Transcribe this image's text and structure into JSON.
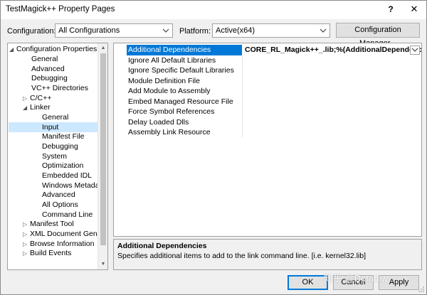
{
  "window": {
    "title": "TestMagick++ Property Pages",
    "help": "?",
    "close": "✕"
  },
  "config": {
    "configuration_label": "Configuration:",
    "configuration_value": "All Configurations",
    "platform_label": "Platform:",
    "platform_value": "Active(x64)",
    "manager_button": "Configuration Manager..."
  },
  "tree": {
    "items": [
      {
        "label": "Configuration Properties",
        "expander": "◢"
      },
      {
        "label": "General"
      },
      {
        "label": "Advanced"
      },
      {
        "label": "Debugging"
      },
      {
        "label": "VC++ Directories"
      },
      {
        "label": "C/C++",
        "expander": "▷"
      },
      {
        "label": "Linker",
        "expander": "◢"
      },
      {
        "label": "General"
      },
      {
        "label": "Input"
      },
      {
        "label": "Manifest File"
      },
      {
        "label": "Debugging"
      },
      {
        "label": "System"
      },
      {
        "label": "Optimization"
      },
      {
        "label": "Embedded IDL"
      },
      {
        "label": "Windows Metadata"
      },
      {
        "label": "Advanced"
      },
      {
        "label": "All Options"
      },
      {
        "label": "Command Line"
      },
      {
        "label": "Manifest Tool",
        "expander": "▷"
      },
      {
        "label": "XML Document Genera",
        "expander": "▷"
      },
      {
        "label": "Browse Information",
        "expander": "▷"
      },
      {
        "label": "Build Events",
        "expander": "▷"
      }
    ]
  },
  "grid": {
    "rows": [
      {
        "name": "Additional Dependencies",
        "value": "CORE_RL_Magick++_.lib;%(AdditionalDependencies)"
      },
      {
        "name": "Ignore All Default Libraries",
        "value": ""
      },
      {
        "name": "Ignore Specific Default Libraries",
        "value": ""
      },
      {
        "name": "Module Definition File",
        "value": ""
      },
      {
        "name": "Add Module to Assembly",
        "value": ""
      },
      {
        "name": "Embed Managed Resource File",
        "value": ""
      },
      {
        "name": "Force Symbol References",
        "value": ""
      },
      {
        "name": "Delay Loaded Dlls",
        "value": ""
      },
      {
        "name": "Assembly Link Resource",
        "value": ""
      }
    ]
  },
  "description": {
    "title": "Additional Dependencies",
    "text": "Specifies additional items to add to the link command line. [i.e. kernel32.lib]"
  },
  "buttons": {
    "ok": "OK",
    "cancel": "Cancel",
    "apply": "Apply"
  },
  "watermark": "知乎 @Dotadiw",
  "colors": {
    "selection": "#0078d7",
    "tree_selection": "#cce8ff",
    "window_bg": "#f0f0f0"
  }
}
